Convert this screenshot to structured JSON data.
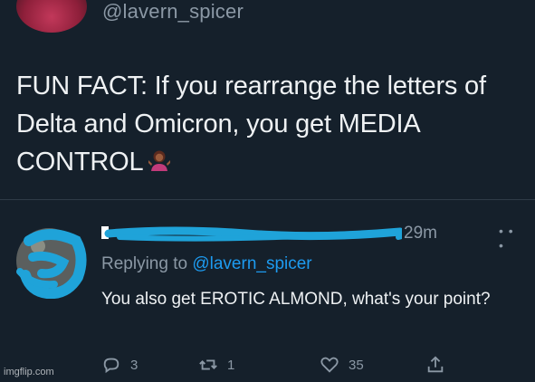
{
  "original_tweet": {
    "handle": "@lavern_spicer",
    "text": "FUN FACT: If you rearrange the letters of Delta and Omicron, you get MEDIA CONTROL",
    "emoji_icon": "person-shrugging-icon"
  },
  "reply": {
    "name_redacted": true,
    "timestamp": "29m",
    "replying_prefix": "Replying to",
    "replying_handle": "@lavern_spicer",
    "text": "You also get EROTIC ALMOND, what's your point?",
    "more_icon": "more-icon"
  },
  "actions": {
    "reply_count": "3",
    "retweet_count": "1",
    "like_count": "35",
    "share_icon": "share-icon"
  },
  "watermark": "imgflip.com",
  "colors": {
    "background": "#15202b",
    "text": "#e7e9ea",
    "secondary": "#8b98a5",
    "link": "#1d9bf0",
    "redaction": "#1fa3d9"
  }
}
